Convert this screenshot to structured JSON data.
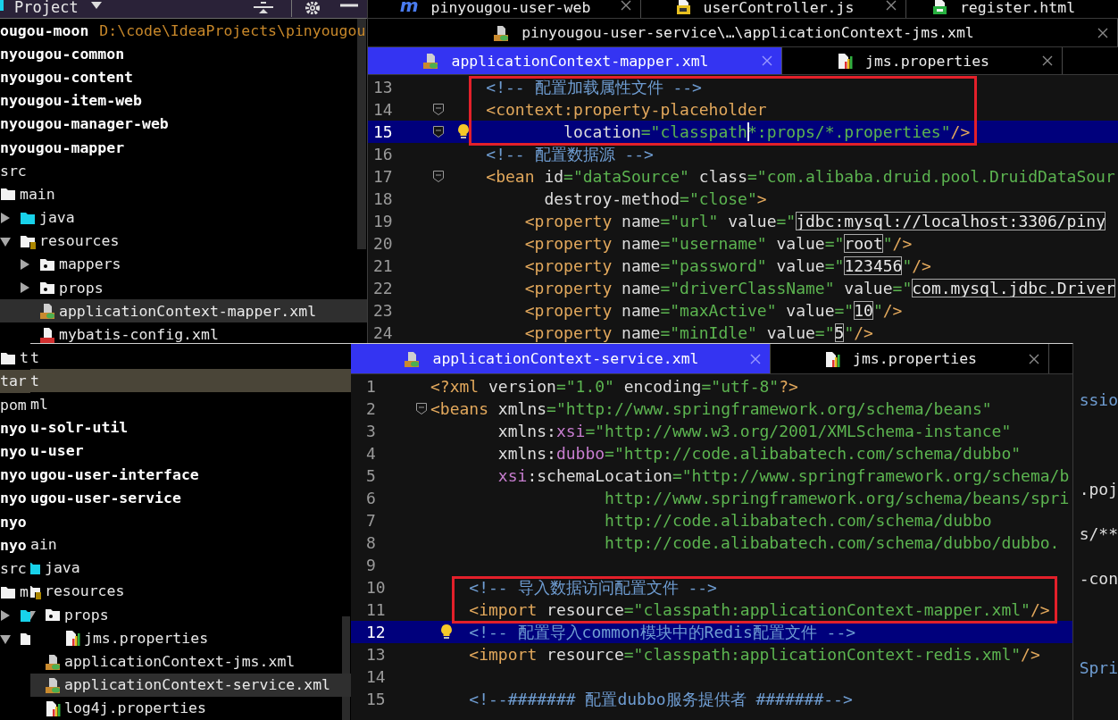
{
  "back_window": {
    "project_panel": {
      "title": "Project",
      "tree": [
        {
          "label": "ougou-moon",
          "bold": true,
          "path": "D:\\code\\IdeaProjects\\pinyougou",
          "selected": false,
          "marked": false,
          "children": [
            {
              "label": "nyougou-common",
              "bold": true,
              "selected": false,
              "marked": false
            },
            {
              "label": "nyougou-content",
              "bold": true,
              "selected": false,
              "marked": false
            },
            {
              "label": "nyougou-item-web",
              "bold": true,
              "selected": false,
              "marked": false
            },
            {
              "label": "nyougou-manager-web",
              "bold": true,
              "selected": false,
              "marked": false
            },
            {
              "label": "nyougou-mapper",
              "bold": true,
              "selected": false,
              "marked": false,
              "children": [
                {
                  "label": "src",
                  "selected": false,
                  "marked": false,
                  "children": [
                    {
                      "label": "main",
                      "kind": "folder",
                      "selected": false,
                      "marked": false,
                      "children": [
                        {
                          "label": "java",
                          "kind": "source-folder",
                          "expanded": false,
                          "selected": false,
                          "marked": false
                        },
                        {
                          "label": "resources",
                          "kind": "resources-folder",
                          "expanded": true,
                          "selected": false,
                          "marked": false,
                          "children": [
                            {
                              "label": "mappers",
                              "kind": "package-folder",
                              "expanded": false,
                              "selected": false,
                              "marked": false
                            },
                            {
                              "label": "props",
                              "kind": "package-folder",
                              "expanded": false,
                              "selected": false,
                              "marked": false
                            },
                            {
                              "label": "applicationContext-mapper.xml",
                              "kind": "xml-spring",
                              "selected": true,
                              "marked": false
                            },
                            {
                              "label": "mybatis-config.xml",
                              "kind": "xml",
                              "selected": false,
                              "marked": false
                            }
                          ]
                        }
                      ]
                    },
                    {
                      "label": "t",
                      "kind": "folder",
                      "selected": false,
                      "marked": false
                    }
                  ]
                },
                {
                  "label": "tar",
                  "selected": false,
                  "marked": true
                },
                {
                  "label": "pom",
                  "selected": false,
                  "marked": false
                }
              ]
            },
            {
              "label": "nyo",
              "bold": true,
              "selected": false,
              "marked": false
            },
            {
              "label": "nyo",
              "bold": true,
              "selected": false,
              "marked": false
            },
            {
              "label": "nyo",
              "bold": true,
              "selected": false,
              "marked": false
            },
            {
              "label": "nyo",
              "bold": true,
              "selected": false,
              "marked": false
            },
            {
              "label": "nyo",
              "bold": true,
              "selected": false,
              "marked": false
            },
            {
              "label": "nyo",
              "bold": true,
              "selected": false,
              "marked": false,
              "children": [
                {
                  "label": "src",
                  "selected": false,
                  "marked": false,
                  "children": [
                    {
                      "label": "m",
                      "kind": "folder",
                      "selected": false,
                      "marked": false,
                      "children": [
                        {
                          "kind": "source-folder",
                          "expanded": false,
                          "selected": false,
                          "marked": false
                        },
                        {
                          "kind": "folder",
                          "expanded": true,
                          "selected": false,
                          "marked": false
                        }
                      ]
                    }
                  ]
                }
              ]
            }
          ]
        }
      ]
    },
    "editor": {
      "tab_rows": [
        [
          {
            "label": "pinyougou-user-web",
            "glyph": "m",
            "selected": false,
            "closable": true
          },
          {
            "label": "userController.js",
            "kind": "js",
            "selected": false,
            "closable": true
          },
          {
            "label": "register.html",
            "kind": "html",
            "selected": false,
            "closable": false
          }
        ],
        [
          {
            "label": "pinyougou-user-service\\…\\applicationContext-jms.xml",
            "kind": "xml-spring",
            "selected": false,
            "closable": true
          }
        ],
        [
          {
            "label": "applicationContext-mapper.xml",
            "kind": "xml-spring",
            "selected": true,
            "closable": true
          },
          {
            "label": "jms.properties",
            "kind": "properties",
            "selected": false,
            "closable": true
          }
        ]
      ],
      "lines": [
        {
          "number": "13",
          "framed": true,
          "current": false,
          "tokens": [
            {
              "kind": "comment",
              "text": "    <!-- 配置加载属性文件 -->"
            }
          ]
        },
        {
          "number": "14",
          "framed": true,
          "current": false,
          "fold": true,
          "tokens": [
            {
              "kind": "tag",
              "text": "    <context:property-placeholder"
            }
          ]
        },
        {
          "number": "15",
          "framed": true,
          "current": true,
          "fold": true,
          "hint": true,
          "tokens": [
            {
              "kind": "attr",
              "text": "            location"
            },
            {
              "kind": "value",
              "text": "=\"classpath",
              "caret": true
            },
            {
              "kind": "value",
              "text": "*:props/*.properties\""
            },
            {
              "kind": "tag",
              "text": "/>"
            }
          ]
        },
        {
          "number": "16",
          "framed": false,
          "current": false,
          "tokens": [
            {
              "kind": "comment",
              "text": "    <!-- 配置数据源 -->"
            }
          ]
        },
        {
          "number": "17",
          "framed": false,
          "current": false,
          "fold": true,
          "tokens": [
            {
              "kind": "tag",
              "text": "    <bean"
            },
            {
              "kind": "attr",
              "text": " id"
            },
            {
              "kind": "value",
              "text": "=\"dataSource\""
            },
            {
              "kind": "attr",
              "text": " class"
            },
            {
              "kind": "value",
              "text": "=\"com.alibaba.druid.pool.DruidDataSour"
            }
          ]
        },
        {
          "number": "18",
          "framed": false,
          "current": false,
          "tokens": [
            {
              "kind": "attr",
              "text": "          destroy-method"
            },
            {
              "kind": "value",
              "text": "=\"close\""
            },
            {
              "kind": "tag",
              "text": ">"
            }
          ]
        },
        {
          "number": "19",
          "framed": false,
          "current": false,
          "tokens": [
            {
              "kind": "tag",
              "text": "        <property"
            },
            {
              "kind": "attr",
              "text": " name"
            },
            {
              "kind": "value",
              "text": "=\"url\""
            },
            {
              "kind": "attr",
              "text": " value"
            },
            {
              "kind": "value",
              "text": "=\""
            },
            {
              "kind": "boxed",
              "text": "jdbc:mysql://localhost:3306/piny"
            }
          ]
        },
        {
          "number": "20",
          "framed": false,
          "current": false,
          "tokens": [
            {
              "kind": "tag",
              "text": "        <property"
            },
            {
              "kind": "attr",
              "text": " name"
            },
            {
              "kind": "value",
              "text": "=\"username\""
            },
            {
              "kind": "attr",
              "text": " value"
            },
            {
              "kind": "value",
              "text": "=\""
            },
            {
              "kind": "boxed",
              "text": "root"
            },
            {
              "kind": "value",
              "text": "\""
            },
            {
              "kind": "tag",
              "text": "/>"
            }
          ]
        },
        {
          "number": "21",
          "framed": false,
          "current": false,
          "tokens": [
            {
              "kind": "tag",
              "text": "        <property"
            },
            {
              "kind": "attr",
              "text": " name"
            },
            {
              "kind": "value",
              "text": "=\"password\""
            },
            {
              "kind": "attr",
              "text": " value"
            },
            {
              "kind": "value",
              "text": "=\""
            },
            {
              "kind": "boxed",
              "text": "123456"
            },
            {
              "kind": "value",
              "text": "\""
            },
            {
              "kind": "tag",
              "text": "/>"
            }
          ]
        },
        {
          "number": "22",
          "framed": false,
          "current": false,
          "tokens": [
            {
              "kind": "tag",
              "text": "        <property"
            },
            {
              "kind": "attr",
              "text": " name"
            },
            {
              "kind": "value",
              "text": "=\"driverClassName\""
            },
            {
              "kind": "attr",
              "text": " value"
            },
            {
              "kind": "value",
              "text": "=\""
            },
            {
              "kind": "boxed",
              "text": "com.mysql.jdbc.Driver"
            }
          ]
        },
        {
          "number": "23",
          "framed": false,
          "current": false,
          "tokens": [
            {
              "kind": "tag",
              "text": "        <property"
            },
            {
              "kind": "attr",
              "text": " name"
            },
            {
              "kind": "value",
              "text": "=\"maxActive\""
            },
            {
              "kind": "attr",
              "text": " value"
            },
            {
              "kind": "value",
              "text": "=\""
            },
            {
              "kind": "boxed",
              "text": "10"
            },
            {
              "kind": "value",
              "text": "\""
            },
            {
              "kind": "tag",
              "text": "/>"
            }
          ]
        },
        {
          "number": "24",
          "framed": false,
          "current": false,
          "tokens": [
            {
              "kind": "tag",
              "text": "        <property"
            },
            {
              "kind": "attr",
              "text": " name"
            },
            {
              "kind": "value",
              "text": "=\"minIdle\""
            },
            {
              "kind": "attr",
              "text": " value"
            },
            {
              "kind": "value",
              "text": "=\""
            },
            {
              "kind": "boxed",
              "text": "5"
            },
            {
              "kind": "value",
              "text": "\""
            },
            {
              "kind": "tag",
              "text": "/>"
            }
          ]
        },
        {
          "current": false
        },
        {
          "current": false
        },
        {
          "current": false,
          "tokens": [
            {
              "kind": "comment",
              "text": "ssio"
            }
          ]
        },
        {
          "current": false
        },
        {
          "current": false
        },
        {
          "current": false
        },
        {
          "current": false,
          "tokens": [
            {
              "kind": "attr",
              "text": ".poj"
            }
          ]
        },
        {
          "current": false
        },
        {
          "current": false,
          "tokens": [
            {
              "kind": "attr",
              "text": "s/**"
            }
          ]
        },
        {
          "current": false
        },
        {
          "current": false,
          "tokens": [
            {
              "kind": "attr",
              "text": "-con"
            }
          ]
        },
        {
          "current": false
        },
        {
          "current": false
        },
        {
          "current": false
        },
        {
          "current": false,
          "tokens": [
            {
              "kind": "comment",
              "text": "Spri"
            }
          ]
        }
      ]
    }
  },
  "front_window": {
    "project_panel": {
      "tree": [
        {
          "label": "t",
          "selected": false,
          "marked": false
        },
        {
          "label": "t",
          "selected": false,
          "marked": true
        },
        {
          "label": "ml",
          "selected": false,
          "marked": false
        },
        {
          "label": "u-solr-util",
          "bold": true,
          "selected": false,
          "marked": false
        },
        {
          "label": "u-user",
          "bold": true,
          "selected": false,
          "marked": false
        },
        {
          "label": "ugou-user-interface",
          "bold": true,
          "selected": false,
          "marked": false
        },
        {
          "label": "ugou-user-service",
          "bold": true,
          "selected": false,
          "marked": false,
          "children": [
            {
              "selected": false,
              "marked": false,
              "children": [
                {
                  "label": "ain",
                  "selected": false,
                  "marked": false,
                  "children": [
                    {
                      "label": "java",
                      "kind": "source-folder",
                      "selected": false,
                      "marked": false
                    },
                    {
                      "label": "resources",
                      "kind": "resources-folder",
                      "selected": false,
                      "marked": false,
                      "children": [
                        {
                          "label": "props",
                          "kind": "package-folder",
                          "expanded": true,
                          "selected": false,
                          "marked": false,
                          "children": [
                            {
                              "label": "jms.properties",
                              "kind": "properties",
                              "selected": false,
                              "marked": false
                            }
                          ]
                        },
                        {
                          "label": "applicationContext-jms.xml",
                          "kind": "xml-spring",
                          "selected": false,
                          "marked": false
                        },
                        {
                          "label": "applicationContext-service.xml",
                          "kind": "xml-spring",
                          "selected": true,
                          "marked": false
                        },
                        {
                          "label": "log4j.properties",
                          "kind": "properties",
                          "selected": false,
                          "marked": false
                        }
                      ]
                    }
                  ]
                }
              ]
            }
          ]
        }
      ]
    },
    "editor": {
      "tab_rows": [
        [
          {
            "label": "applicationContext-service.xml",
            "kind": "xml-spring",
            "selected": true,
            "closable": true
          },
          {
            "label": "jms.properties",
            "kind": "properties",
            "selected": false,
            "closable": true
          }
        ]
      ],
      "lines": [
        {
          "number": "1",
          "framed": false,
          "current": false,
          "tokens": [
            {
              "kind": "tag",
              "text": "<?xml"
            },
            {
              "kind": "attr",
              "text": " version"
            },
            {
              "kind": "value",
              "text": "=\"1.0\""
            },
            {
              "kind": "attr",
              "text": " encoding"
            },
            {
              "kind": "value",
              "text": "=\"utf-8\""
            },
            {
              "kind": "tag",
              "text": "?>"
            }
          ]
        },
        {
          "number": "2",
          "framed": false,
          "current": false,
          "fold": true,
          "tokens": [
            {
              "kind": "tag",
              "text": "<beans"
            },
            {
              "kind": "attr",
              "text": " xmlns"
            },
            {
              "kind": "value",
              "text": "=\"http://www.springframework.org/schema/beans\""
            }
          ]
        },
        {
          "number": "3",
          "framed": false,
          "current": false,
          "tokens": [
            {
              "kind": "attr",
              "text": "       xmlns:"
            },
            {
              "kind": "ns",
              "text": "xsi"
            },
            {
              "kind": "value",
              "text": "=\"http://www.w3.org/2001/XMLSchema-instance\""
            }
          ]
        },
        {
          "number": "4",
          "framed": false,
          "current": false,
          "tokens": [
            {
              "kind": "attr",
              "text": "       xmlns:"
            },
            {
              "kind": "ns",
              "text": "dubbo"
            },
            {
              "kind": "value",
              "text": "=\"http://code.alibabatech.com/schema/dubbo\""
            }
          ]
        },
        {
          "number": "5",
          "framed": false,
          "current": false,
          "tokens": [
            {
              "kind": "ns",
              "text": "       xsi"
            },
            {
              "kind": "attr",
              "text": ":schemaLocation"
            },
            {
              "kind": "value",
              "text": "=\"http://www.springframework.org/schema/b"
            }
          ]
        },
        {
          "number": "6",
          "framed": false,
          "current": false,
          "tokens": [
            {
              "kind": "value",
              "text": "                  http://www.springframework.org/schema/beans/spri"
            }
          ]
        },
        {
          "number": "7",
          "framed": false,
          "current": false,
          "tokens": [
            {
              "kind": "value",
              "text": "                  http://code.alibabatech.com/schema/dubbo"
            }
          ]
        },
        {
          "number": "8",
          "framed": false,
          "current": false,
          "tokens": [
            {
              "kind": "value",
              "text": "                  http://code.alibabatech.com/schema/dubbo/dubbo."
            }
          ]
        },
        {
          "number": "9",
          "framed": false,
          "current": false
        },
        {
          "number": "10",
          "framed": true,
          "current": false,
          "tokens": [
            {
              "kind": "comment",
              "text": "    <!-- 导入数据访问配置文件 -->"
            }
          ]
        },
        {
          "number": "11",
          "framed": true,
          "current": false,
          "tokens": [
            {
              "kind": "tag",
              "text": "    <import"
            },
            {
              "kind": "attr",
              "text": " resource"
            },
            {
              "kind": "value",
              "text": "=\"classpath:applicationContext-mapper.xml\""
            },
            {
              "kind": "tag",
              "text": "/>"
            }
          ]
        },
        {
          "number": "12",
          "framed": false,
          "current": true,
          "hint": true,
          "tokens": [
            {
              "kind": "comment",
              "text": "    <!-- 配置导入common模块中的Redis配置文件 -->"
            }
          ]
        },
        {
          "number": "13",
          "framed": false,
          "current": false,
          "tokens": [
            {
              "kind": "tag",
              "text": "    <import"
            },
            {
              "kind": "attr",
              "text": " resource"
            },
            {
              "kind": "value",
              "text": "=\"classpath:applicationContext-redis.xml\""
            },
            {
              "kind": "tag",
              "text": "/>"
            }
          ]
        },
        {
          "number": "14",
          "framed": false,
          "current": false
        },
        {
          "number": "15",
          "framed": false,
          "current": false,
          "tokens": [
            {
              "kind": "comment",
              "text": "    <!--####### 配置dubbo服务提供者 #######-->"
            }
          ]
        }
      ]
    }
  }
}
